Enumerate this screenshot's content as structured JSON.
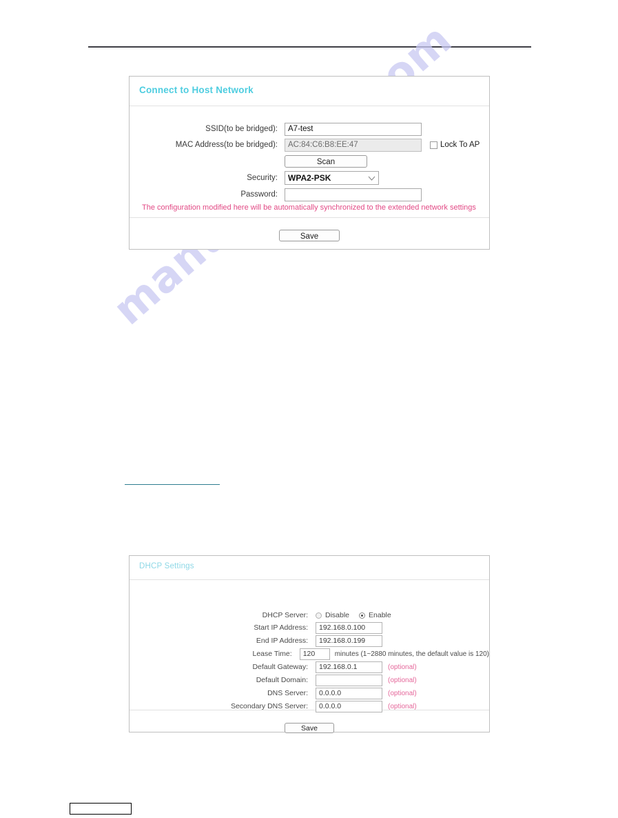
{
  "page": {
    "watermark_text": "manualshive.com"
  },
  "host_network_panel": {
    "title": "Connect to Host Network",
    "fields": {
      "ssid_label": "SSID(to be bridged):",
      "ssid_value": "A7-test",
      "mac_label": "MAC Address(to be bridged):",
      "mac_value": "AC:84:C6:B8:EE:47",
      "lock_to_ap_label": "Lock To AP",
      "lock_to_ap_checked": false,
      "scan_label": "Scan",
      "security_label": "Security:",
      "security_value": "WPA2-PSK",
      "security_options": [
        "WPA2-PSK"
      ],
      "password_label": "Password:",
      "password_value": "",
      "warning": "The configuration modified here will be automatically synchronized to the extended network settings"
    },
    "save_label": "Save"
  },
  "dhcp_panel": {
    "title": "DHCP Settings",
    "fields": {
      "dhcp_server_label": "DHCP Server:",
      "dhcp_disable_label": "Disable",
      "dhcp_enable_label": "Enable",
      "dhcp_selected": "Enable",
      "start_ip_label": "Start IP Address:",
      "start_ip_value": "192.168.0.100",
      "end_ip_label": "End IP Address:",
      "end_ip_value": "192.168.0.199",
      "lease_time_label": "Lease Time:",
      "lease_time_value": "120",
      "lease_time_hint": "minutes (1~2880 minutes, the default value is 120)",
      "gateway_label": "Default Gateway:",
      "gateway_value": "192.168.0.1",
      "gateway_optional": "(optional)",
      "domain_label": "Default Domain:",
      "domain_value": "",
      "domain_optional": "(optional)",
      "dns_label": "DNS Server:",
      "dns_value": "0.0.0.0",
      "dns_optional": "(optional)",
      "secondary_dns_label": "Secondary DNS Server:",
      "secondary_dns_value": "0.0.0.0",
      "secondary_dns_optional": "(optional)"
    },
    "save_label": "Save"
  },
  "colors": {
    "panel_title": "#4ecde0",
    "warning_text": "#e24a85",
    "optional_text": "#e5679a",
    "rule_dark": "#3f3f46",
    "rule_teal": "#2e7d8f"
  }
}
